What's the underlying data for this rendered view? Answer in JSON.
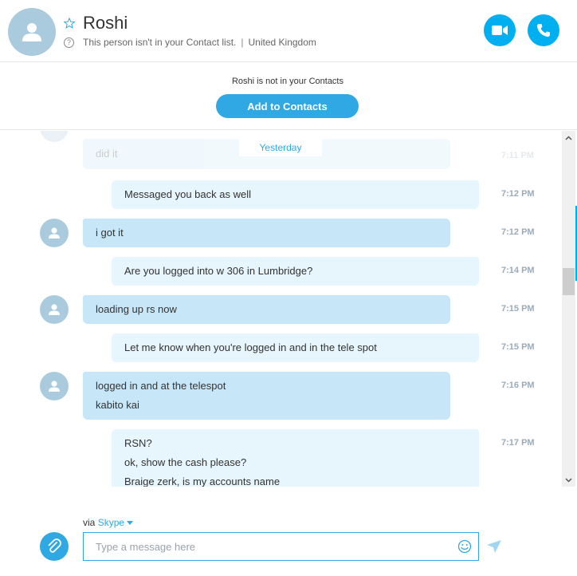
{
  "header": {
    "contact_name": "Roshi",
    "status_text": "This person isn't in your Contact list.",
    "separator": "|",
    "location": "United Kingdom",
    "icons": [
      "avatar-icon",
      "star-icon",
      "help-icon",
      "video-call-icon",
      "phone-call-icon"
    ]
  },
  "add_panel": {
    "notice": "Roshi is not in your Contacts",
    "button_label": "Add to Contacts"
  },
  "conversation": {
    "date_divider": "Yesterday",
    "faded_message": {
      "text": "did it",
      "time": "7:11 PM"
    },
    "messages": [
      {
        "direction": "out",
        "lines": [
          "Messaged you back as well"
        ],
        "time": "7:12 PM"
      },
      {
        "direction": "in",
        "lines": [
          "i got it"
        ],
        "time": "7:12 PM"
      },
      {
        "direction": "out",
        "lines": [
          "Are you logged into w 306 in Lumbridge?"
        ],
        "time": "7:14 PM"
      },
      {
        "direction": "in",
        "lines": [
          "loading up rs now"
        ],
        "time": "7:15 PM"
      },
      {
        "direction": "out",
        "lines": [
          "Let me know when you're logged in and in the tele spot"
        ],
        "time": "7:15 PM"
      },
      {
        "direction": "in",
        "lines": [
          "logged in and at the telespot",
          "kabito kai"
        ],
        "time": "7:16 PM"
      },
      {
        "direction": "out",
        "lines": [
          "RSN?",
          "ok, show the cash please?",
          "Braige zerk, is my accounts name"
        ],
        "time": "7:17 PM"
      }
    ]
  },
  "composer": {
    "via_prefix": "via",
    "via_service": "Skype",
    "placeholder": "Type a message here",
    "icons": [
      "attach-icon",
      "emoji-icon",
      "send-icon",
      "dropdown-caret-icon"
    ]
  },
  "colors": {
    "accent": "#00aff0",
    "button_blue": "#2fa8e3",
    "incoming_bubble": "#c7e7f9",
    "outgoing_bubble": "#e7f5fd",
    "avatar_bg": "#aacbde",
    "timestamp": "#9aabb8"
  }
}
